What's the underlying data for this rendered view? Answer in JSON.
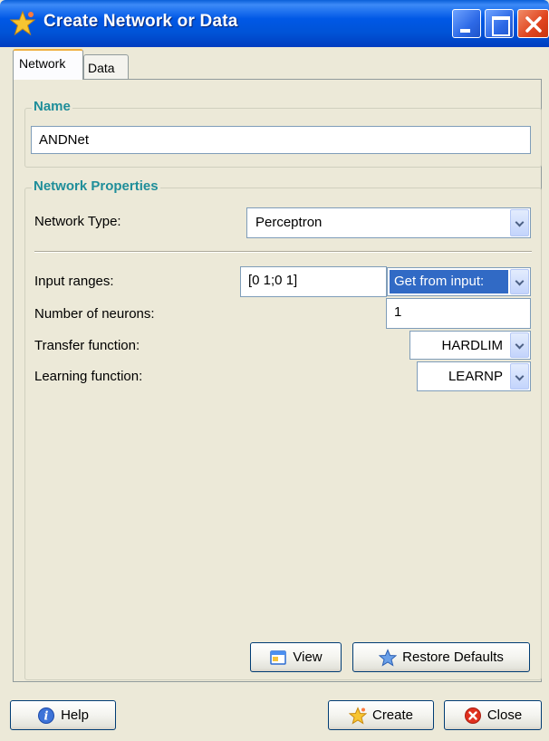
{
  "window": {
    "title": "Create Network or Data",
    "title_icon": "star-sparkle-icon"
  },
  "tabs": [
    {
      "label": "Network",
      "selected": true
    },
    {
      "label": "Data",
      "selected": false
    }
  ],
  "name_group": {
    "legend": "Name",
    "value": "ANDNet"
  },
  "properties_group": {
    "legend": "Network Properties",
    "network_type_label": "Network Type:",
    "network_type_value": "Perceptron",
    "input_ranges_label": "Input ranges:",
    "input_ranges_value": "[0 1;0 1]",
    "input_source_value": "Get from input:",
    "neurons_label": "Number of neurons:",
    "neurons_value": "1",
    "transfer_label": "Transfer function:",
    "transfer_value": "HARDLIM",
    "learning_label": "Learning function:",
    "learning_value": "LEARNP"
  },
  "buttons": {
    "view": "View",
    "restore": "Restore Defaults",
    "help": "Help",
    "create": "Create",
    "close": "Close"
  },
  "colors": {
    "titlebar": "#0058e6",
    "legend_text": "#1f8e9a",
    "selection": "#316ac5",
    "dialog_bg": "#ece9d8"
  }
}
